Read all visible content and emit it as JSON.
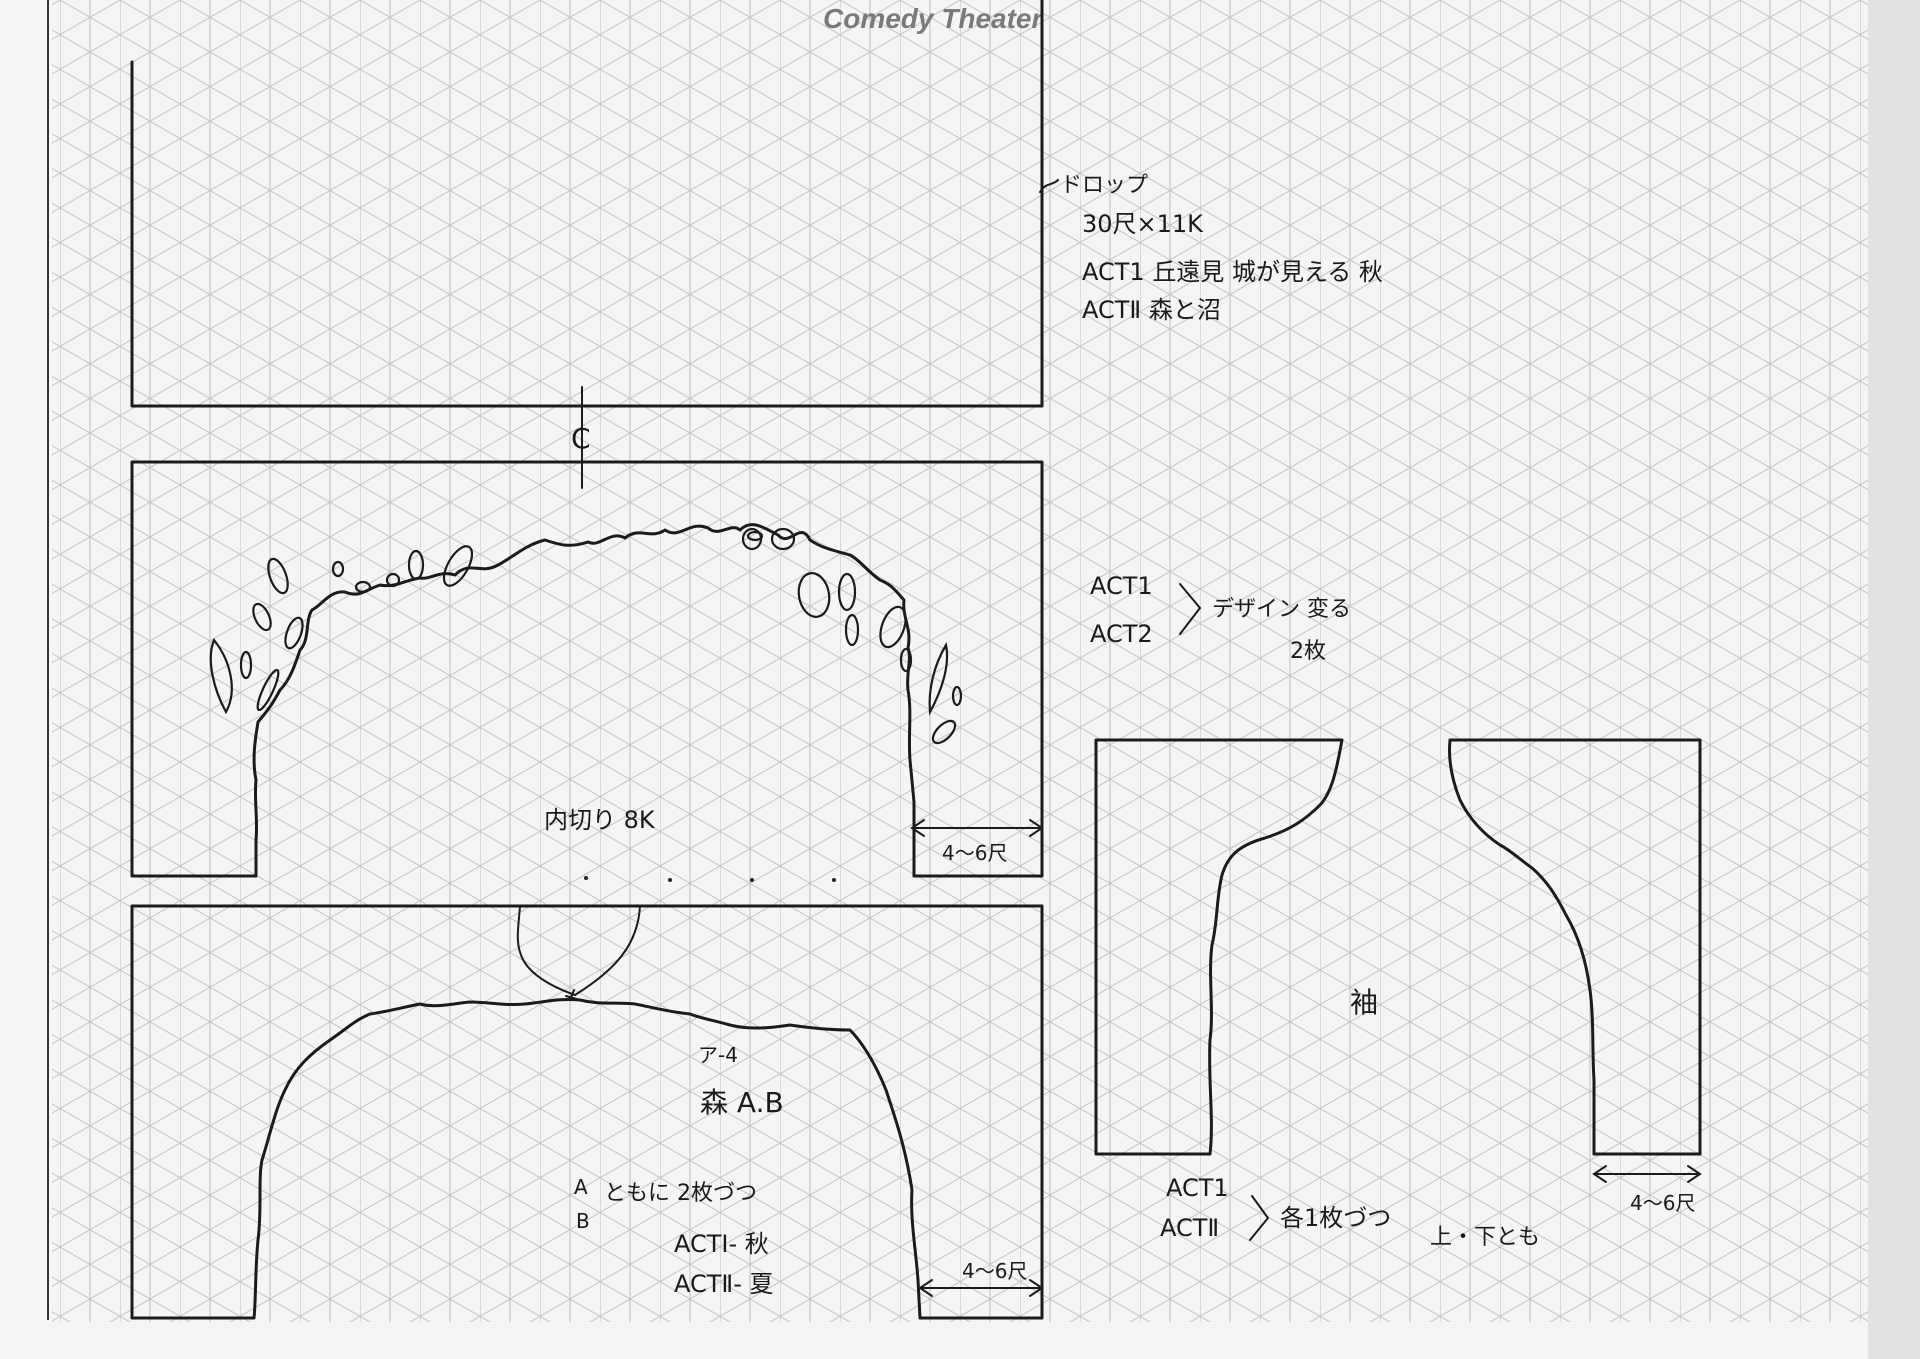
{
  "header": {
    "brand": "Comedy Theater"
  },
  "backdrop": {
    "line1": "ドロップ",
    "line2": "30尺×11K",
    "line3": "ACT1 丘遠見 城が見える 秋",
    "line4": "ACTⅡ 森と沼"
  },
  "center_mark": "C",
  "inner_frame": {
    "label": "内切り 8K",
    "dimension": "4〜6尺"
  },
  "design_note": {
    "act1": "ACT1",
    "act2": "ACT2",
    "note": "デザイン 変る",
    "count": "2枚"
  },
  "forest": {
    "ref": "ア-4",
    "title": "森 A.B",
    "note_a": "A",
    "note_b": "B",
    "note_both": "ともに 2枚づつ",
    "act1": "ACTⅠ- 秋",
    "act2": "ACTⅡ- 夏",
    "dimension": "4〜6尺"
  },
  "wing": {
    "label": "袖",
    "act1": "ACT1",
    "act2": "ACTⅡ",
    "note": "各1枚づつ",
    "note2": "上・下とも",
    "dimension": "4〜6尺"
  },
  "colors": {
    "paper": "#f4f4f4",
    "grid": "#b9b9b9",
    "ink": "#1b1b1b"
  }
}
